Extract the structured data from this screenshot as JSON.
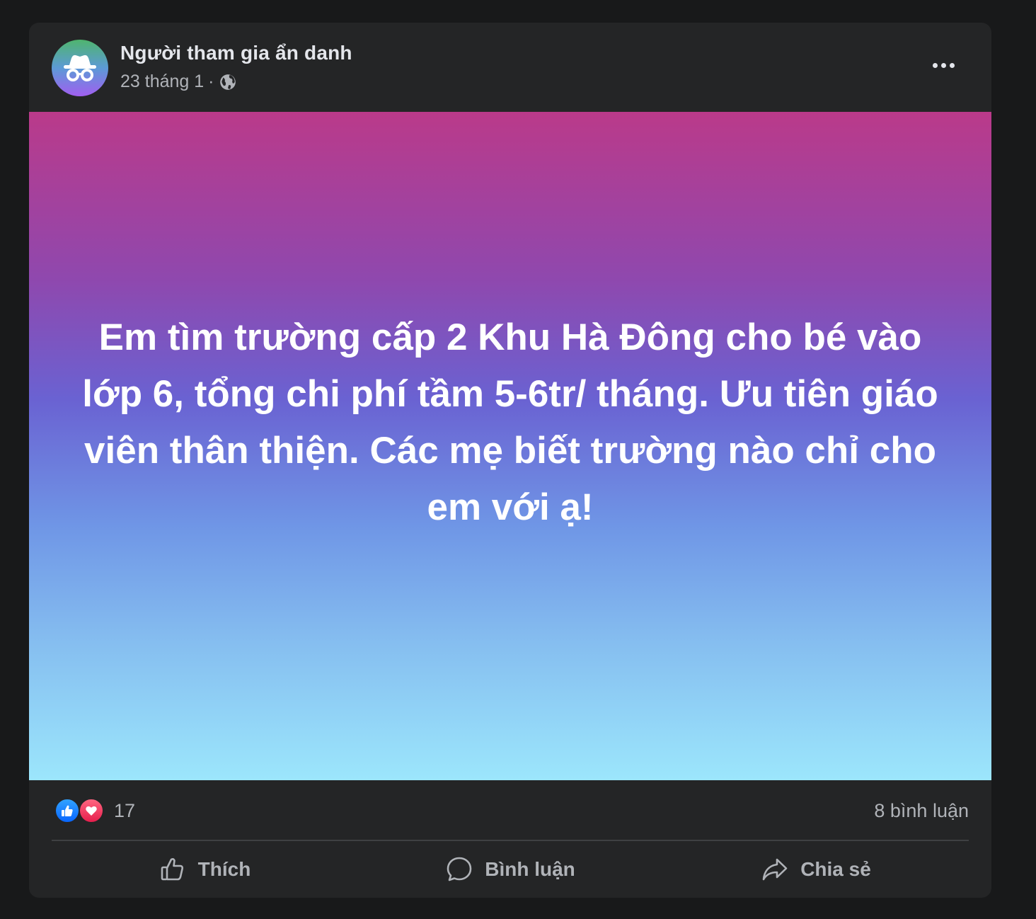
{
  "post": {
    "author": "Người tham gia ẩn danh",
    "date": "23 tháng 1",
    "separator": "·",
    "privacy_icon": "globe-icon",
    "more_icon": "more-horizontal-icon",
    "text": "Em tìm trường cấp 2 Khu Hà Đông cho bé vào lớp 6, tổng chi phí tầm 5-6tr/ tháng. Ưu tiên giáo viên thân thiện. Các mẹ biết trường nào chỉ cho em với ạ!",
    "background_gradient": [
      "#ba3a8a",
      "#6a62d2",
      "#9ce6fc"
    ]
  },
  "stats": {
    "reaction_icons": [
      "like-icon",
      "love-icon"
    ],
    "reaction_count": "17",
    "comment_count": "8 bình luận"
  },
  "actions": {
    "like_label": "Thích",
    "comment_label": "Bình luận",
    "share_label": "Chia sẻ"
  },
  "colors": {
    "card_bg": "#242526",
    "page_bg": "#18191a",
    "primary_text": "#e4e6eb",
    "secondary_text": "#b0b3b8",
    "like_blue": "#0866ff",
    "love_red": "#e61e4d"
  }
}
